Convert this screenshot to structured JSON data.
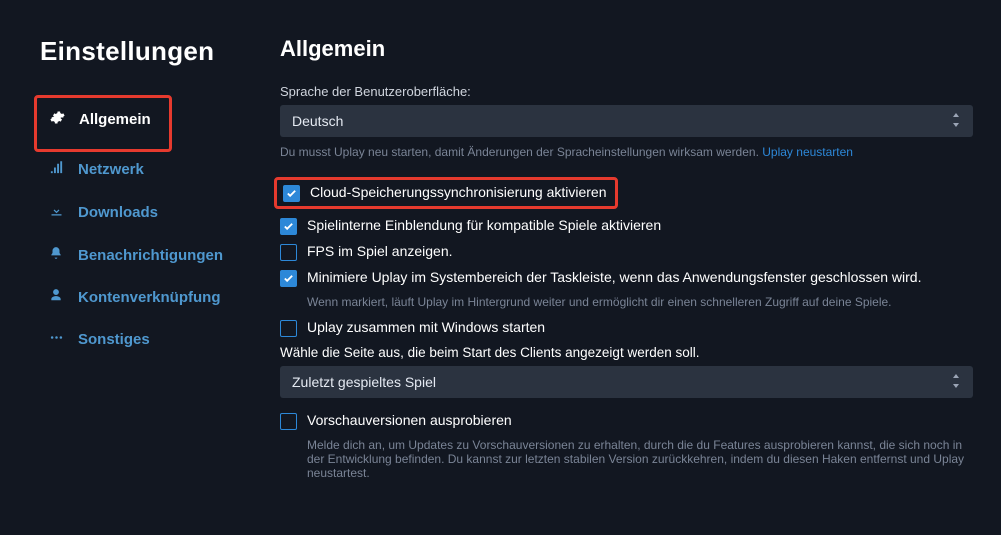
{
  "sidebar": {
    "title": "Einstellungen",
    "items": [
      {
        "icon": "gear",
        "label": "Allgemein",
        "active": true
      },
      {
        "icon": "signal",
        "label": "Netzwerk"
      },
      {
        "icon": "download",
        "label": "Downloads"
      },
      {
        "icon": "bell",
        "label": "Benachrichtigungen"
      },
      {
        "icon": "user",
        "label": "Kontenverknüpfung"
      },
      {
        "icon": "dots",
        "label": "Sonstiges"
      }
    ]
  },
  "main": {
    "heading": "Allgemein",
    "language_label": "Sprache der Benutzeroberfläche:",
    "language_value": "Deutsch",
    "language_hint": "Du musst Uplay neu starten, damit Änderungen der Spracheinstellungen wirksam werden. ",
    "language_restart_link": "Uplay neustarten",
    "checkboxes": {
      "cloud_sync": {
        "checked": true,
        "label": "Cloud-Speicherungssynchronisierung aktivieren"
      },
      "overlay": {
        "checked": true,
        "label": "Spielinterne Einblendung für kompatible Spiele aktivieren"
      },
      "fps": {
        "checked": false,
        "label": "FPS im Spiel anzeigen."
      },
      "minimize": {
        "checked": true,
        "label": "Minimiere Uplay im Systembereich der Taskleiste, wenn das Anwendungsfenster geschlossen wird."
      },
      "minimize_hint": "Wenn markiert, läuft Uplay im Hintergrund weiter und ermöglicht dir einen schnelleren Zugriff auf deine Spiele.",
      "autostart": {
        "checked": false,
        "label": "Uplay zusammen mit Windows starten"
      },
      "preview": {
        "checked": false,
        "label": "Vorschauversionen ausprobieren"
      },
      "preview_hint": "Melde dich an, um Updates zu Vorschauversionen zu erhalten, durch die du Features ausprobieren kannst, die sich noch in der Entwicklung befinden. Du kannst zur letzten stabilen Version zurückkehren, indem du diesen Haken entfernst und Uplay neustartest."
    },
    "startpage_label": "Wähle die Seite aus, die beim Start des Clients angezeigt werden soll.",
    "startpage_value": "Zuletzt gespieltes Spiel"
  }
}
